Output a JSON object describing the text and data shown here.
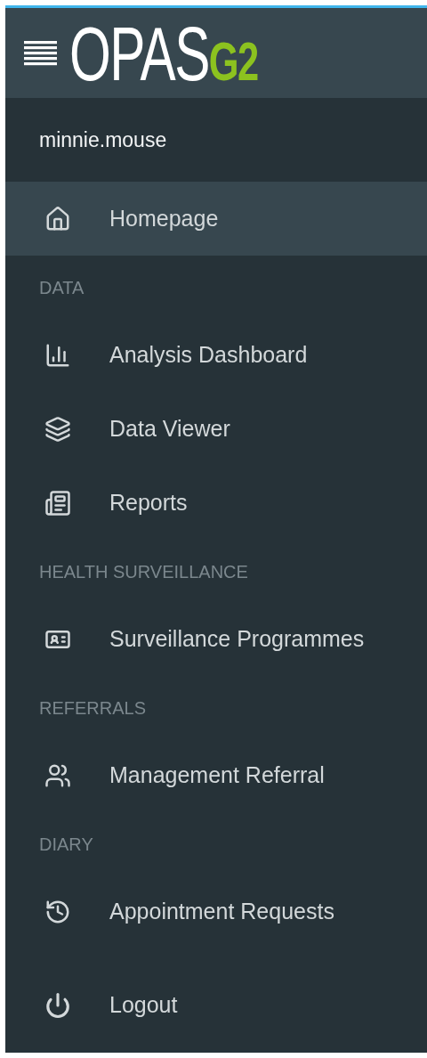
{
  "header": {
    "logo": "OPAS",
    "logo_suffix": "G2"
  },
  "user": {
    "name": "minnie.mouse"
  },
  "groups": [
    {
      "items": [
        {
          "label": "Homepage",
          "selected": true
        }
      ]
    },
    {
      "heading": "DATA",
      "items": [
        {
          "label": "Analysis Dashboard",
          "selected": false
        },
        {
          "label": "Data Viewer",
          "selected": false
        },
        {
          "label": "Reports",
          "selected": false
        }
      ]
    },
    {
      "heading": "HEALTH SURVEILLANCE",
      "items": [
        {
          "label": "Surveillance Programmes",
          "selected": false
        }
      ]
    },
    {
      "heading": "REFERRALS",
      "items": [
        {
          "label": "Management Referral",
          "selected": false
        }
      ]
    },
    {
      "heading": "DIARY",
      "items": [
        {
          "label": "Appointment Requests",
          "selected": false
        }
      ]
    }
  ],
  "logout": {
    "label": "Logout"
  }
}
